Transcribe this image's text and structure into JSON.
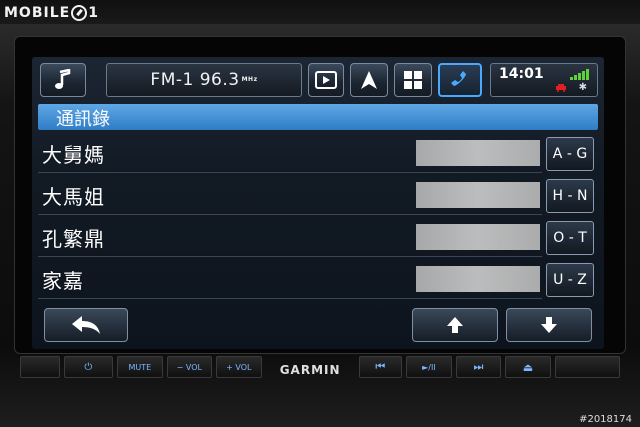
{
  "watermark": {
    "text_left": "MOBILE",
    "text_right": "1"
  },
  "topbar": {
    "radio_text": "FM-1 96.3",
    "radio_unit": "MHz",
    "time": "14:01",
    "icons": [
      "music-note-icon",
      "play-media-icon",
      "navigation-arrow-icon",
      "grid-apps-icon",
      "phone-icon",
      "signal-bars-icon",
      "car-icon",
      "bluetooth-icon"
    ]
  },
  "header": {
    "title": "通訊錄"
  },
  "contacts": [
    {
      "name": "大舅媽"
    },
    {
      "name": "大馬姐"
    },
    {
      "name": "孔繁鼎"
    },
    {
      "name": "家嘉"
    }
  ],
  "alpha_index": [
    "A - G",
    "H - N",
    "O - T",
    "U - Z"
  ],
  "hardware": {
    "power": "⏻",
    "mute": "MUTE",
    "vol_down": "− VOL",
    "vol_up": "+ VOL",
    "brand": "GARMIN",
    "prev": "⏮",
    "play_pause": "►/II",
    "next": "⏭",
    "eject": "⏏"
  },
  "footer": {
    "id": "#2018174"
  },
  "colors": {
    "accent": "#4aa8ff",
    "header": "#3f8fd6",
    "signal": "#5fd23a"
  }
}
